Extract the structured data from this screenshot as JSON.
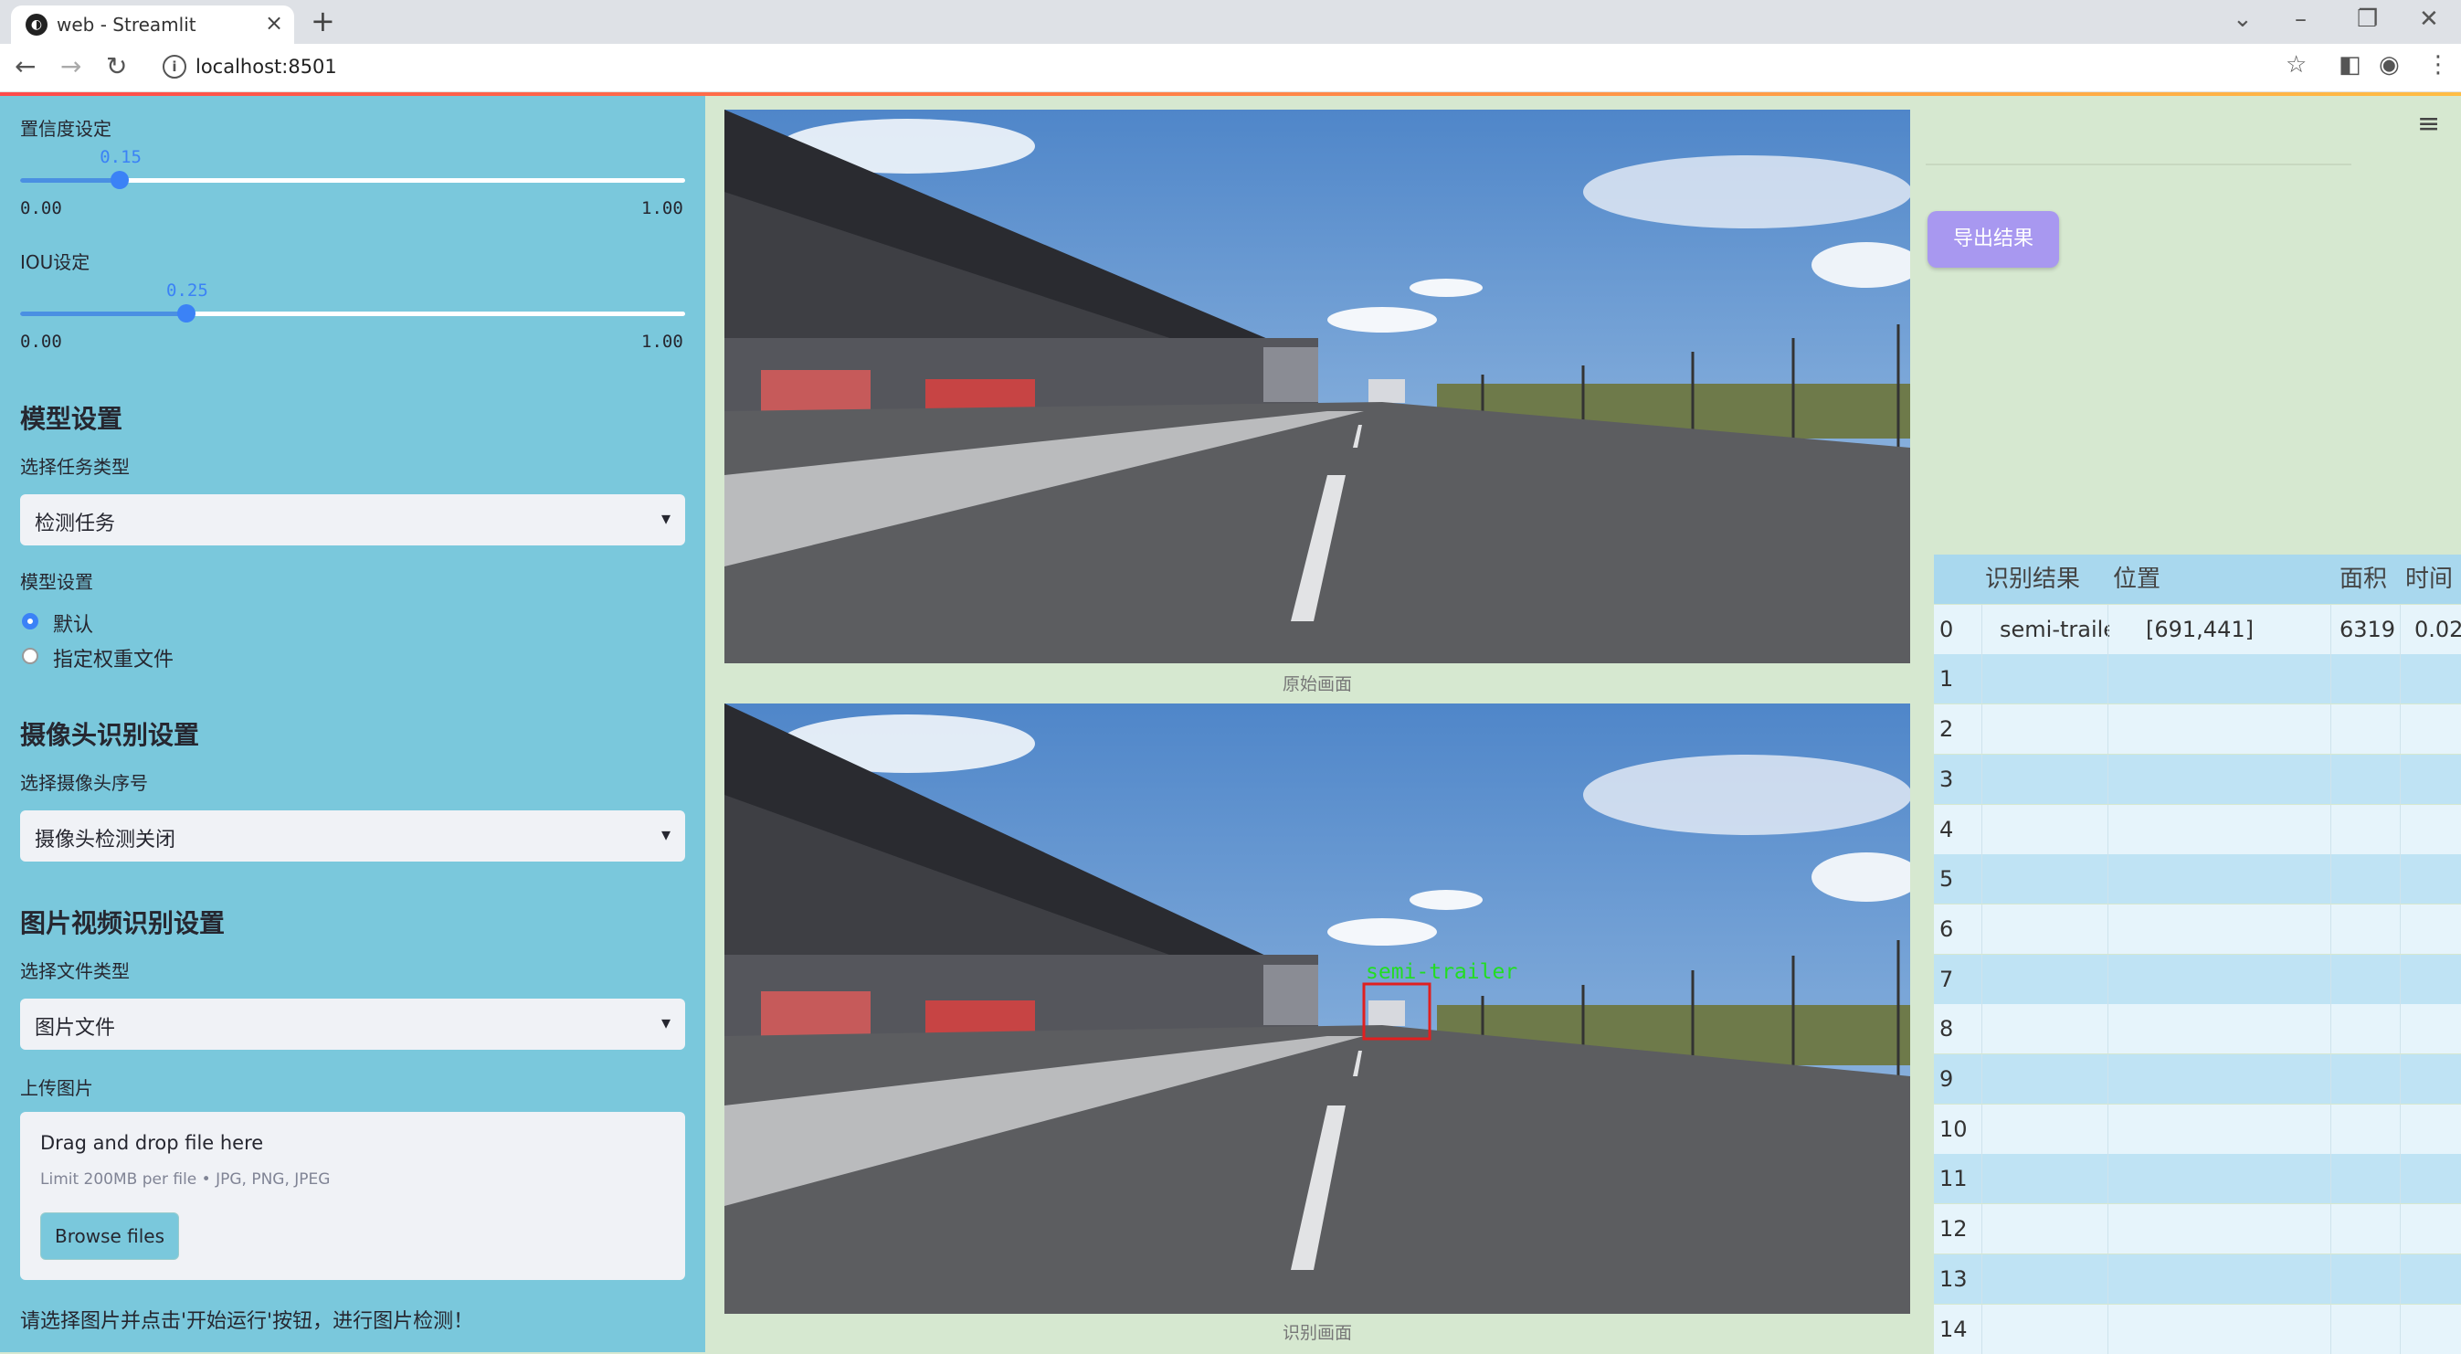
{
  "browser": {
    "tab_title": "web - Streamlit",
    "url": "localhost:8501"
  },
  "sidebar": {
    "confidence": {
      "label": "置信度设定",
      "value": "0.15",
      "min": "0.00",
      "max": "1.00",
      "fraction": 0.15
    },
    "iou": {
      "label": "IOU设定",
      "value": "0.25",
      "min": "0.00",
      "max": "1.00",
      "fraction": 0.25
    },
    "model_section": {
      "heading": "模型设置",
      "task_label": "选择任务类型",
      "task_value": "检测任务",
      "weights_label": "模型设置",
      "radio_default": "默认",
      "radio_custom": "指定权重文件"
    },
    "camera_section": {
      "heading": "摄像头识别设置",
      "label": "选择摄像头序号",
      "value": "摄像头检测关闭"
    },
    "media_section": {
      "heading": "图片视频识别设置",
      "file_type_label": "选择文件类型",
      "file_type_value": "图片文件",
      "upload_label": "上传图片",
      "drop_text": "Drag and drop file here",
      "limit_text": "Limit 200MB per file • JPG, PNG, JPEG",
      "browse_label": "Browse files"
    },
    "hint": "请选择图片并点击'开始运行'按钮，进行图片检测！"
  },
  "main": {
    "original_caption": "原始画面",
    "detected_caption": "识别画面",
    "detection_label": "semi-trailer",
    "export_button": "导出结果"
  },
  "results_table": {
    "headers": [
      "",
      "识别结果",
      "位置",
      "面积",
      "时间"
    ],
    "rows": [
      [
        "0",
        "semi-trailer",
        "[691,441]",
        "6319",
        "0.02"
      ],
      [
        "1",
        "",
        "",
        "",
        ""
      ],
      [
        "2",
        "",
        "",
        "",
        ""
      ],
      [
        "3",
        "",
        "",
        "",
        ""
      ],
      [
        "4",
        "",
        "",
        "",
        ""
      ],
      [
        "5",
        "",
        "",
        "",
        ""
      ],
      [
        "6",
        "",
        "",
        "",
        ""
      ],
      [
        "7",
        "",
        "",
        "",
        ""
      ],
      [
        "8",
        "",
        "",
        "",
        ""
      ],
      [
        "9",
        "",
        "",
        "",
        ""
      ],
      [
        "10",
        "",
        "",
        "",
        ""
      ],
      [
        "11",
        "",
        "",
        "",
        ""
      ],
      [
        "12",
        "",
        "",
        "",
        ""
      ],
      [
        "13",
        "",
        "",
        "",
        ""
      ],
      [
        "14",
        "",
        "",
        "",
        ""
      ]
    ]
  },
  "colors": {
    "sidebar_bg": "#7ac8dc",
    "main_bg": "#d6e8d0",
    "accent": "#3b82f6",
    "export_button": "#a898f0",
    "detection_box": "#e02020",
    "detection_text": "#22dd22"
  }
}
